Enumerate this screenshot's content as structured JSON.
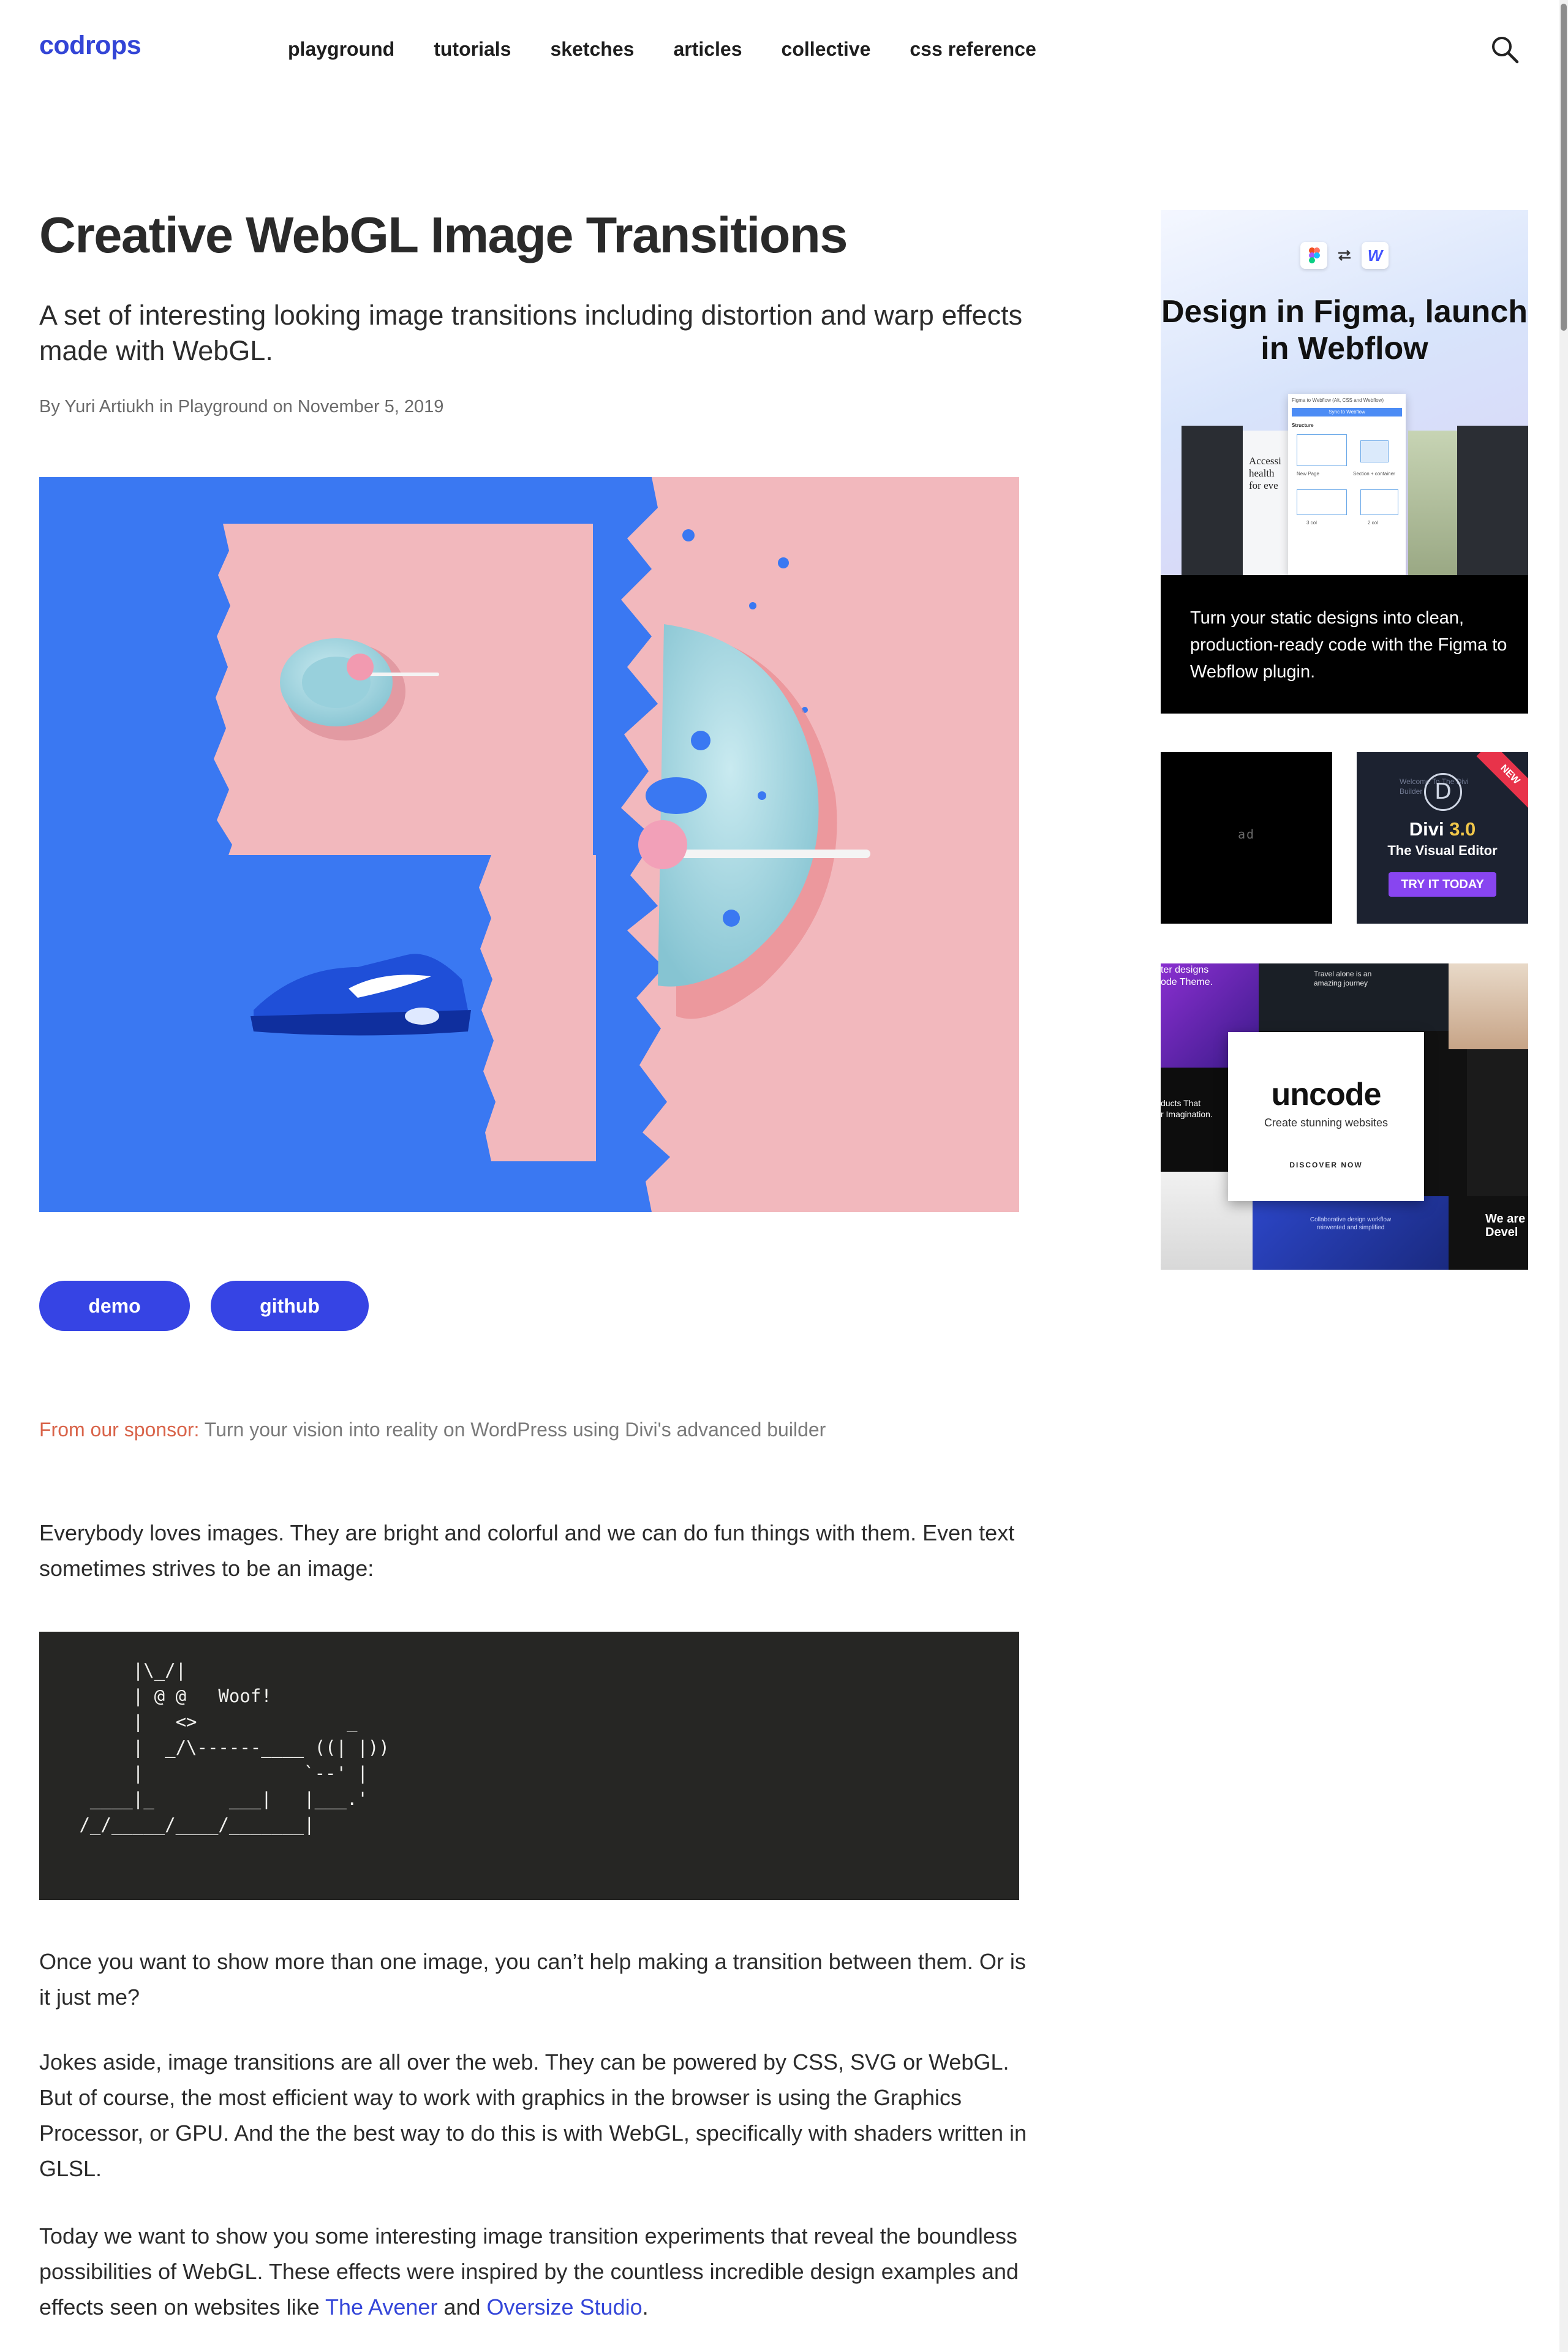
{
  "header": {
    "logo": "codrops",
    "nav": [
      "playground",
      "tutorials",
      "sketches",
      "articles",
      "collective",
      "css reference"
    ],
    "search_icon": "search-icon"
  },
  "article": {
    "title": "Creative WebGL Image Transitions",
    "subtitle": "A set of interesting looking image transitions including distortion and warp effects made with WebGL.",
    "byline": "By Yuri Artiukh in Playground on November 5, 2019",
    "buttons": {
      "demo": "demo",
      "github": "github"
    },
    "sponsor_label": "From our sponsor:",
    "sponsor_text": " Turn your vision into reality on WordPress using Divi's advanced builder",
    "p1": "Everybody loves images. They are bright and colorful and we can do fun things with them. Even text sometimes strives to be an image:",
    "code": "      |\\_/|\n      | @ @   Woof!\n      |   <>              _\n      |  _/\\------____ ((| |))\n      |               `--' |\n  ____|_       ___|   |___.'\n /_/_____/____/_______|",
    "p2": "Once you want to show more than one image, you can’t help making a transition between them. Or is it just me?",
    "p3": "Jokes aside, image transitions are all over the web. They can be powered by CSS, SVG or WebGL. But of course, the most efficient way to work with graphics in the browser is using the Graphics Processor, or GPU. And the the best way to do this is with WebGL, specifically with shaders written in GLSL.",
    "p4_before": "Today we want to show you some interesting image transition experiments that reveal the boundless possibilities of WebGL. These effects were inspired by the countless incredible design examples and effects seen on websites like ",
    "p4_link1": "The Avener",
    "p4_mid": " and ",
    "p4_link2": "Oversize Studio",
    "p4_after": "."
  },
  "sidebar": {
    "ad1": {
      "headline": "Design in Figma, launch in Webflow",
      "text": "Turn your static designs into clean, production-ready code with the Figma to Webflow plugin.",
      "tiny_logo": "W",
      "mock": {
        "title": "Figma to Webflow (Alt, CSS and Webflow)",
        "button": "Sync to Webflow",
        "section": "Structure",
        "labels": [
          "New Page",
          "Section + container",
          "3 col",
          "2 col"
        ],
        "card_text": [
          "Accessi",
          "health",
          "for eve"
        ]
      }
    },
    "ad2": {
      "label": "ad"
    },
    "ad3": {
      "brand": "Divi",
      "version": "3.0",
      "subtitle": "The Visual Editor",
      "cta": "TRY IT TODAY",
      "badge": "NEW",
      "bg_text": "Welcome To The Divi Builder"
    },
    "ad4": {
      "brand": "uncode",
      "tagline": "Create stunning websites",
      "cta": "DISCOVER NOW",
      "snippets": [
        "ter designs",
        "ode Theme.",
        "Travel alone is an amazing journey",
        "ducts That",
        "r Imagination.",
        "We are",
        "Devel",
        "Collaborative design workflow reinvented and simplified"
      ]
    }
  },
  "colors": {
    "accent": "#3644e4",
    "link": "#3446d9",
    "sponsor": "#d9644a",
    "hero_blue": "#3a78f2",
    "hero_pink": "#f2b8bd",
    "code_bg": "#262624"
  }
}
